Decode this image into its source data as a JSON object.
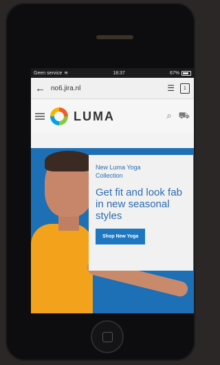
{
  "status": {
    "carrier": "Geen service",
    "time": "18:37",
    "battery": "67%"
  },
  "browser": {
    "url": "no6.jira.nl",
    "tab_count": "1"
  },
  "header": {
    "brand": "LUMA"
  },
  "hero": {
    "subtitle": "New Luma Yoga Collection",
    "headline": "Get fit and look fab in new seasonal styles",
    "cta": "Shop New Yoga"
  },
  "colors": {
    "brand_blue": "#1d78c1",
    "hero_bg": "#1d6fb6"
  }
}
